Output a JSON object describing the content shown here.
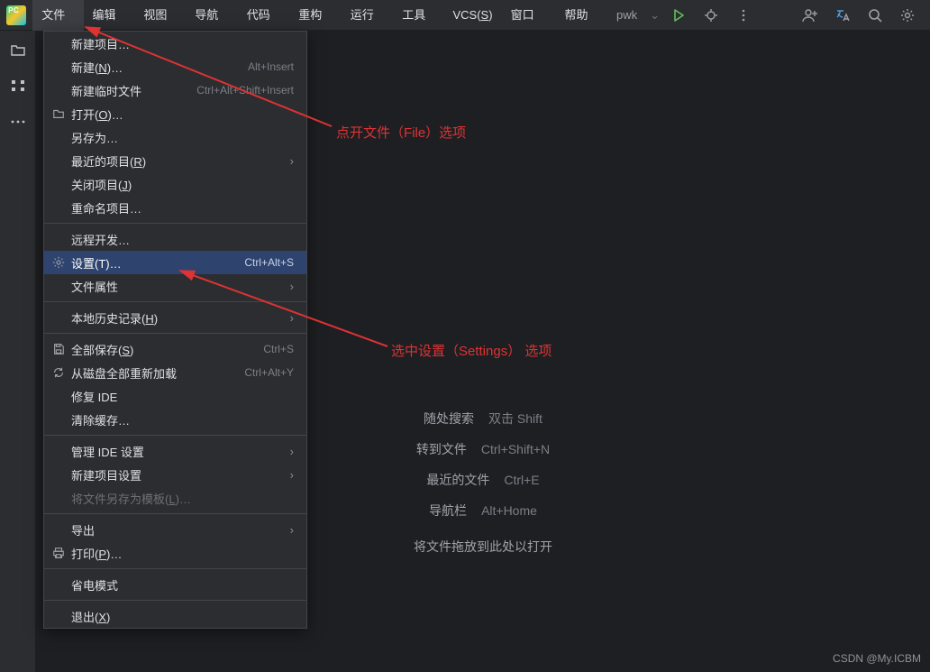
{
  "project": "pwk",
  "menubar": [
    {
      "label": "文件",
      "mn": "F",
      "open": true
    },
    {
      "label": "编辑",
      "mn": "E"
    },
    {
      "label": "视图",
      "mn": "V"
    },
    {
      "label": "导航",
      "mn": "N"
    },
    {
      "label": "代码",
      "mn": "C"
    },
    {
      "label": "重构",
      "mn": "R"
    },
    {
      "label": "运行",
      "mn": "U"
    },
    {
      "label": "工具",
      "mn": "T"
    },
    {
      "label": "VCS",
      "mn": "S"
    },
    {
      "label": "窗口",
      "mn": "W"
    },
    {
      "label": "帮助",
      "mn": "H"
    }
  ],
  "file_menu": [
    {
      "label": "新建项目…"
    },
    {
      "label": "新建",
      "mn": "N",
      "suffix": "…",
      "shortcut": "Alt+Insert"
    },
    {
      "label": "新建临时文件",
      "shortcut": "Ctrl+Alt+Shift+Insert"
    },
    {
      "label": "打开",
      "mn": "O",
      "suffix": "…",
      "icon": "folder"
    },
    {
      "label": "另存为…"
    },
    {
      "label": "最近的项目",
      "mn": "R",
      "submenu": true
    },
    {
      "label": "关闭项目",
      "mn": "J"
    },
    {
      "label": "重命名项目…"
    },
    {
      "sep": true
    },
    {
      "label": "远程开发…"
    },
    {
      "label": "设置",
      "mn": "T",
      "suffix": "…",
      "shortcut": "Ctrl+Alt+S",
      "icon": "gear",
      "selected": true
    },
    {
      "label": "文件属性",
      "submenu": true
    },
    {
      "sep": true
    },
    {
      "label": "本地历史记录",
      "mn": "H",
      "submenu": true
    },
    {
      "sep": true
    },
    {
      "label": "全部保存",
      "mn": "S",
      "shortcut": "Ctrl+S",
      "icon": "save"
    },
    {
      "label": "从磁盘全部重新加载",
      "shortcut": "Ctrl+Alt+Y",
      "icon": "reload"
    },
    {
      "label": "修复 IDE"
    },
    {
      "label": "清除缓存…"
    },
    {
      "sep": true
    },
    {
      "label": "管理 IDE 设置",
      "submenu": true
    },
    {
      "label": "新建项目设置",
      "submenu": true
    },
    {
      "label": "将文件另存为模板",
      "mn": "L",
      "suffix": "…",
      "disabled": true
    },
    {
      "sep": true
    },
    {
      "label": "导出",
      "submenu": true
    },
    {
      "label": "打印",
      "mn": "P",
      "suffix": "…",
      "icon": "print"
    },
    {
      "sep": true
    },
    {
      "label": "省电模式"
    },
    {
      "sep": true
    },
    {
      "label": "退出",
      "mn": "X"
    }
  ],
  "hints": [
    {
      "label": "随处搜索",
      "key": "双击 Shift"
    },
    {
      "label": "转到文件",
      "key": "Ctrl+Shift+N"
    },
    {
      "label": "最近的文件",
      "key": "Ctrl+E"
    },
    {
      "label": "导航栏",
      "key": "Alt+Home"
    }
  ],
  "hint_drop": "将文件拖放到此处以打开",
  "annotations": {
    "top": "点开文件（File）选项",
    "mid": "选中设置（Settings） 选项"
  },
  "watermark": "CSDN @My.ICBM"
}
